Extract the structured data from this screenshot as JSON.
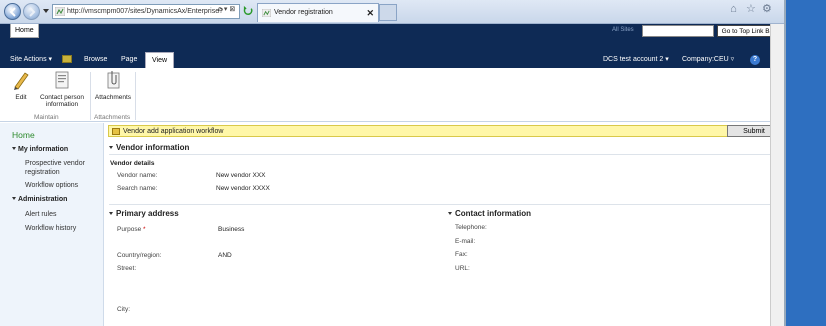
{
  "browser": {
    "url": "http://vmscmpm007/sites/DynamicsAx/Enterprise?",
    "address_buttons": "ρ ▾ ⊠",
    "tab_title": "Vendor registration",
    "tab_close": "✕"
  },
  "sharepoint": {
    "home_tab": "Home",
    "all_sites": "All Sites",
    "top_link_button": "Go to Top Link Bar",
    "ribbon_tabs": {
      "site_actions": "Site Actions ▾",
      "browse": "Browse",
      "page": "Page",
      "view": "View"
    },
    "user_menu": "DCS test account 2  ▾",
    "company": "Company:CEU  ▿",
    "help": "?"
  },
  "ribbon": {
    "edit": "Edit",
    "contact_person": "Contact person information",
    "attachments": "Attachments",
    "group_maintain": "Maintain",
    "group_attachments": "Attachments"
  },
  "leftnav": {
    "home": "Home",
    "my_information": "My information",
    "prospective_vendor": "Prospective vendor registration",
    "workflow_options": "Workflow options",
    "administration": "Administration",
    "alert_rules": "Alert rules",
    "workflow_history": "Workflow history"
  },
  "main": {
    "workflow_bar": "Vendor add application workflow",
    "submit": "Submit",
    "vendor_information": "Vendor information",
    "vendor_details": "Vendor details",
    "vendor_name_label": "Vendor name:",
    "vendor_name_value": "New vendor XXX",
    "search_name_label": "Search name:",
    "search_name_value": "New vendor XXXX",
    "primary_address": "Primary address",
    "purpose_label": "Purpose",
    "purpose_required": "*",
    "purpose_value": "Business",
    "country_label": "Country/region:",
    "country_value": "AND",
    "street_label": "Street:",
    "city_label": "City:",
    "contact_information": "Contact information",
    "telephone_label": "Telephone:",
    "email_label": "E-mail:",
    "fax_label": "Fax:",
    "url_label": "URL:"
  },
  "colors": {
    "header_navy": "#0e2a55",
    "workflow_yellow": "#fff7a8",
    "home_green": "#2d8a2d",
    "desktop_blue": "#2e6fc0"
  }
}
